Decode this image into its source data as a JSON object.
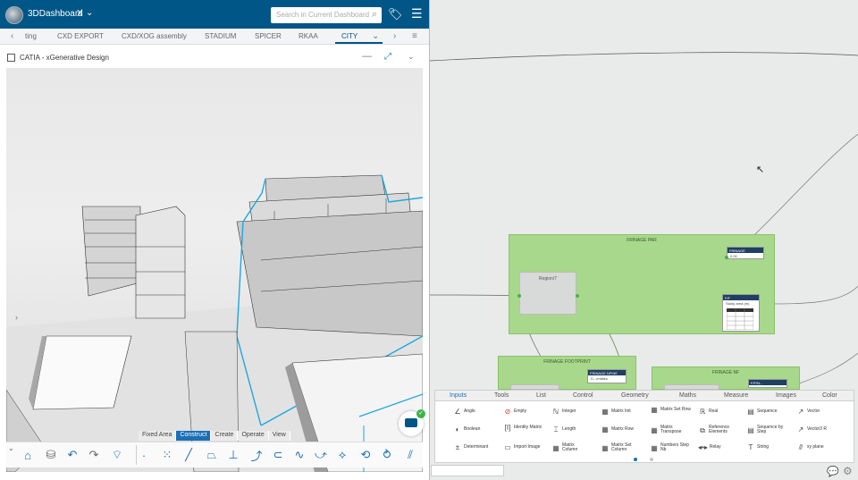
{
  "topbar": {
    "title": "3DDashboard",
    "title_close": "X",
    "title_chevron": "⌄",
    "search_placeholder": "Search in Current Dashboard",
    "accent": "#005686"
  },
  "tabs": [
    {
      "label": "ting"
    },
    {
      "label": "CXD EXPORT"
    },
    {
      "label": "CXD/XOG assembly"
    },
    {
      "label": "STADIUM"
    },
    {
      "label": "SPICER"
    },
    {
      "label": "RKAA"
    },
    {
      "label": "CITY",
      "active": true
    }
  ],
  "app": {
    "name": "CATIA - xGenerative Design"
  },
  "toolbar": {
    "tabs": [
      {
        "label": "Fixed Area"
      },
      {
        "label": "Construct",
        "active": true
      },
      {
        "label": "Create"
      },
      {
        "label": "Operate"
      },
      {
        "label": "View"
      }
    ]
  },
  "graph": {
    "groups": [
      {
        "title": "FRINAGE PAR"
      },
      {
        "title": "FRINAGE FOOTPRINT"
      },
      {
        "title": "FRINAGE NF"
      }
    ],
    "nodes": {
      "region": "Region/7",
      "dark1_title": "FRINAGE",
      "dark1_body": "0.00",
      "dark2_title": "F/F",
      "dark2_body": "Study area (m)",
      "dark3_title": "FRINAGE NFINE",
      "dark3_body": "D...entities",
      "dark4_title": "F/F/N..."
    }
  },
  "palette": {
    "tabs": [
      "Inputs",
      "Tools",
      "List",
      "Control",
      "Geometry",
      "Maths",
      "Measure",
      "Images",
      "Color"
    ],
    "active_tab": "Inputs",
    "rows": [
      [
        "Angle",
        "Empty",
        "Integer",
        "Matrix Init",
        "Matrix Set Row",
        "Real",
        "Sequence",
        "Vector"
      ],
      [
        "Boolean",
        "Identity Matrix",
        "Length",
        "Matrix Row",
        "Matrix Transpose",
        "Reference Elements",
        "Sequence by Step",
        "Vector3 R"
      ],
      [
        "Determinant",
        "Import Image",
        "Matrix Column",
        "Matrix Set Column",
        "Numbers Step Nb",
        "Relay",
        "String",
        "xy plane"
      ]
    ]
  }
}
